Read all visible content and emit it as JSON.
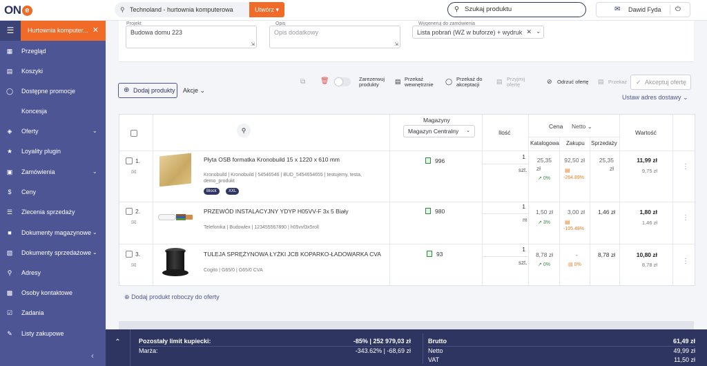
{
  "app": {
    "logo": "ON",
    "logo_e": "e"
  },
  "topbar": {
    "context": "Technoland - hurtownia komputerowa",
    "create_label": "Utwórz",
    "search_placeholder": "Szukaj produktu",
    "user_name": "Dawid Fyda"
  },
  "sidebar": {
    "tab_label": "Hurtownia komputer...",
    "items": [
      {
        "label": "Przegląd",
        "icon": "grid-icon"
      },
      {
        "label": "Koszyki",
        "icon": "basket-icon"
      },
      {
        "label": "Dostępne promocje",
        "icon": "bulb-icon"
      },
      {
        "label": "Koncesja",
        "icon": ""
      },
      {
        "label": "Oferty",
        "icon": "tag-icon"
      },
      {
        "label": "Loyality plugin",
        "icon": "trophy-icon"
      },
      {
        "label": "Zamówienia",
        "icon": "window-icon"
      },
      {
        "label": "Ceny",
        "icon": "dollar-icon"
      },
      {
        "label": "Zlecenia sprzedaży",
        "icon": "list-icon"
      },
      {
        "label": "Dokumenty magazynowe",
        "icon": "box-icon"
      },
      {
        "label": "Dokumenty sprzedażowe",
        "icon": "doc-icon"
      },
      {
        "label": "Adresy",
        "icon": "pin-icon"
      },
      {
        "label": "Osoby kontaktowe",
        "icon": "contacts-icon"
      },
      {
        "label": "Zadania",
        "icon": "check-icon"
      },
      {
        "label": "Listy zakupowe",
        "icon": "cart-list-icon"
      }
    ]
  },
  "form": {
    "project_label": "Projekt",
    "project_value": "Budowa domu 223",
    "desc_label": "Opis",
    "desc_placeholder": "Opis dodatkowy",
    "gen_label": "Wygeneruj do zamówienia",
    "gen_value": "Lista pobrań (WZ w buforze) + wydruk"
  },
  "toolbar": {
    "reserve": "Zarezerwuj produkty",
    "internal": "Przekaż wewnętrznie",
    "approval": "Przekaż do akceptacji",
    "accept_offer_small": "Przyjmij ofertę",
    "reject": "Odrzuć ofertę",
    "print": "Przekaż",
    "accept_offer": "Akceptuj ofertę",
    "add_products": "Dodaj produkty",
    "actions": "Akcje",
    "set_address": "Ustaw adres dostawy"
  },
  "table": {
    "headers": {
      "warehouses": "Magazyny",
      "warehouse_select": "Magazyn Centralny",
      "qty": "Ilość",
      "price": "Cena",
      "net": "Netto",
      "catalog": "Katalogowa",
      "purchase": "Zakupu",
      "sales": "Sprzedaży",
      "value": "Wartość"
    },
    "rows": [
      {
        "no": "1.",
        "name": "Płyta OSB formatka Kronobuild 15 x 1220 x 610 mm",
        "meta": "Kronobuild | Kronobuild | 54546546 | BUD_5454654655 | testujemy, testa,",
        "meta2": "demo_produkt",
        "badges": [
          "Block",
          "XXL"
        ],
        "stock": "996",
        "qty": "1",
        "unit": "szt.",
        "catalog": "25,35",
        "catalog2": "zł",
        "catalog_pct": "0%",
        "purchase": "92,50 zł",
        "purchase_pct": "-264.89%",
        "sales": "25,35",
        "sales2": "zł",
        "value": "11,99 zł",
        "value_gross": "9,75 zł"
      },
      {
        "no": "2.",
        "name": "PRZEWÓD INSTALACYJNY YDYP H05VV-F 3x 5 Biały",
        "meta": "Telefonika | Budowlex | 123455567890 | h05vvf3x5roll",
        "meta2": "",
        "badges": [],
        "stock": "980",
        "qty": "1",
        "unit": "m",
        "catalog": "1,50 zł",
        "catalog2": "",
        "catalog_pct": "3%",
        "purchase": "3,00 zł",
        "purchase_pct": "-105.48%",
        "sales": "1,46 zł",
        "sales2": "",
        "value": "1,80 zł",
        "value_gross": "1,46 zł"
      },
      {
        "no": "3.",
        "name": "TULEJA SPRĘŻYNOWA ŁYŻKI JCB KOPARKO-ŁADOWARKA CVA",
        "meta": "Cogito | G65/0 | G65/0 CVA",
        "meta2": "",
        "badges": [],
        "stock": "93",
        "qty": "1",
        "unit": "szt.",
        "catalog": "8,78 zł",
        "catalog2": "",
        "catalog_pct": "0%",
        "purchase": "-",
        "purchase_pct": "0%",
        "sales": "8,78 zł",
        "sales2": "",
        "value": "10,80 zł",
        "value_gross": "8,78 zł"
      }
    ],
    "add_draft": "Dodaj produkt roboczy do oferty"
  },
  "footer": {
    "limit_label": "Pozostały limit kupiecki:",
    "limit_value": "-85% | 252 979,03 zł",
    "margin_label": "Marża:",
    "margin_value": "-343.62% | -68,69 zł",
    "gross_label": "Brutto",
    "gross_value": "61,49 zł",
    "net_label": "Netto",
    "net_value": "49,99 zł",
    "vat_label": "VAT",
    "vat_value": "11,50 zł"
  },
  "colors": {
    "accent": "#f06a28",
    "sidebar": "#4d5595",
    "navy": "#2e3560"
  }
}
